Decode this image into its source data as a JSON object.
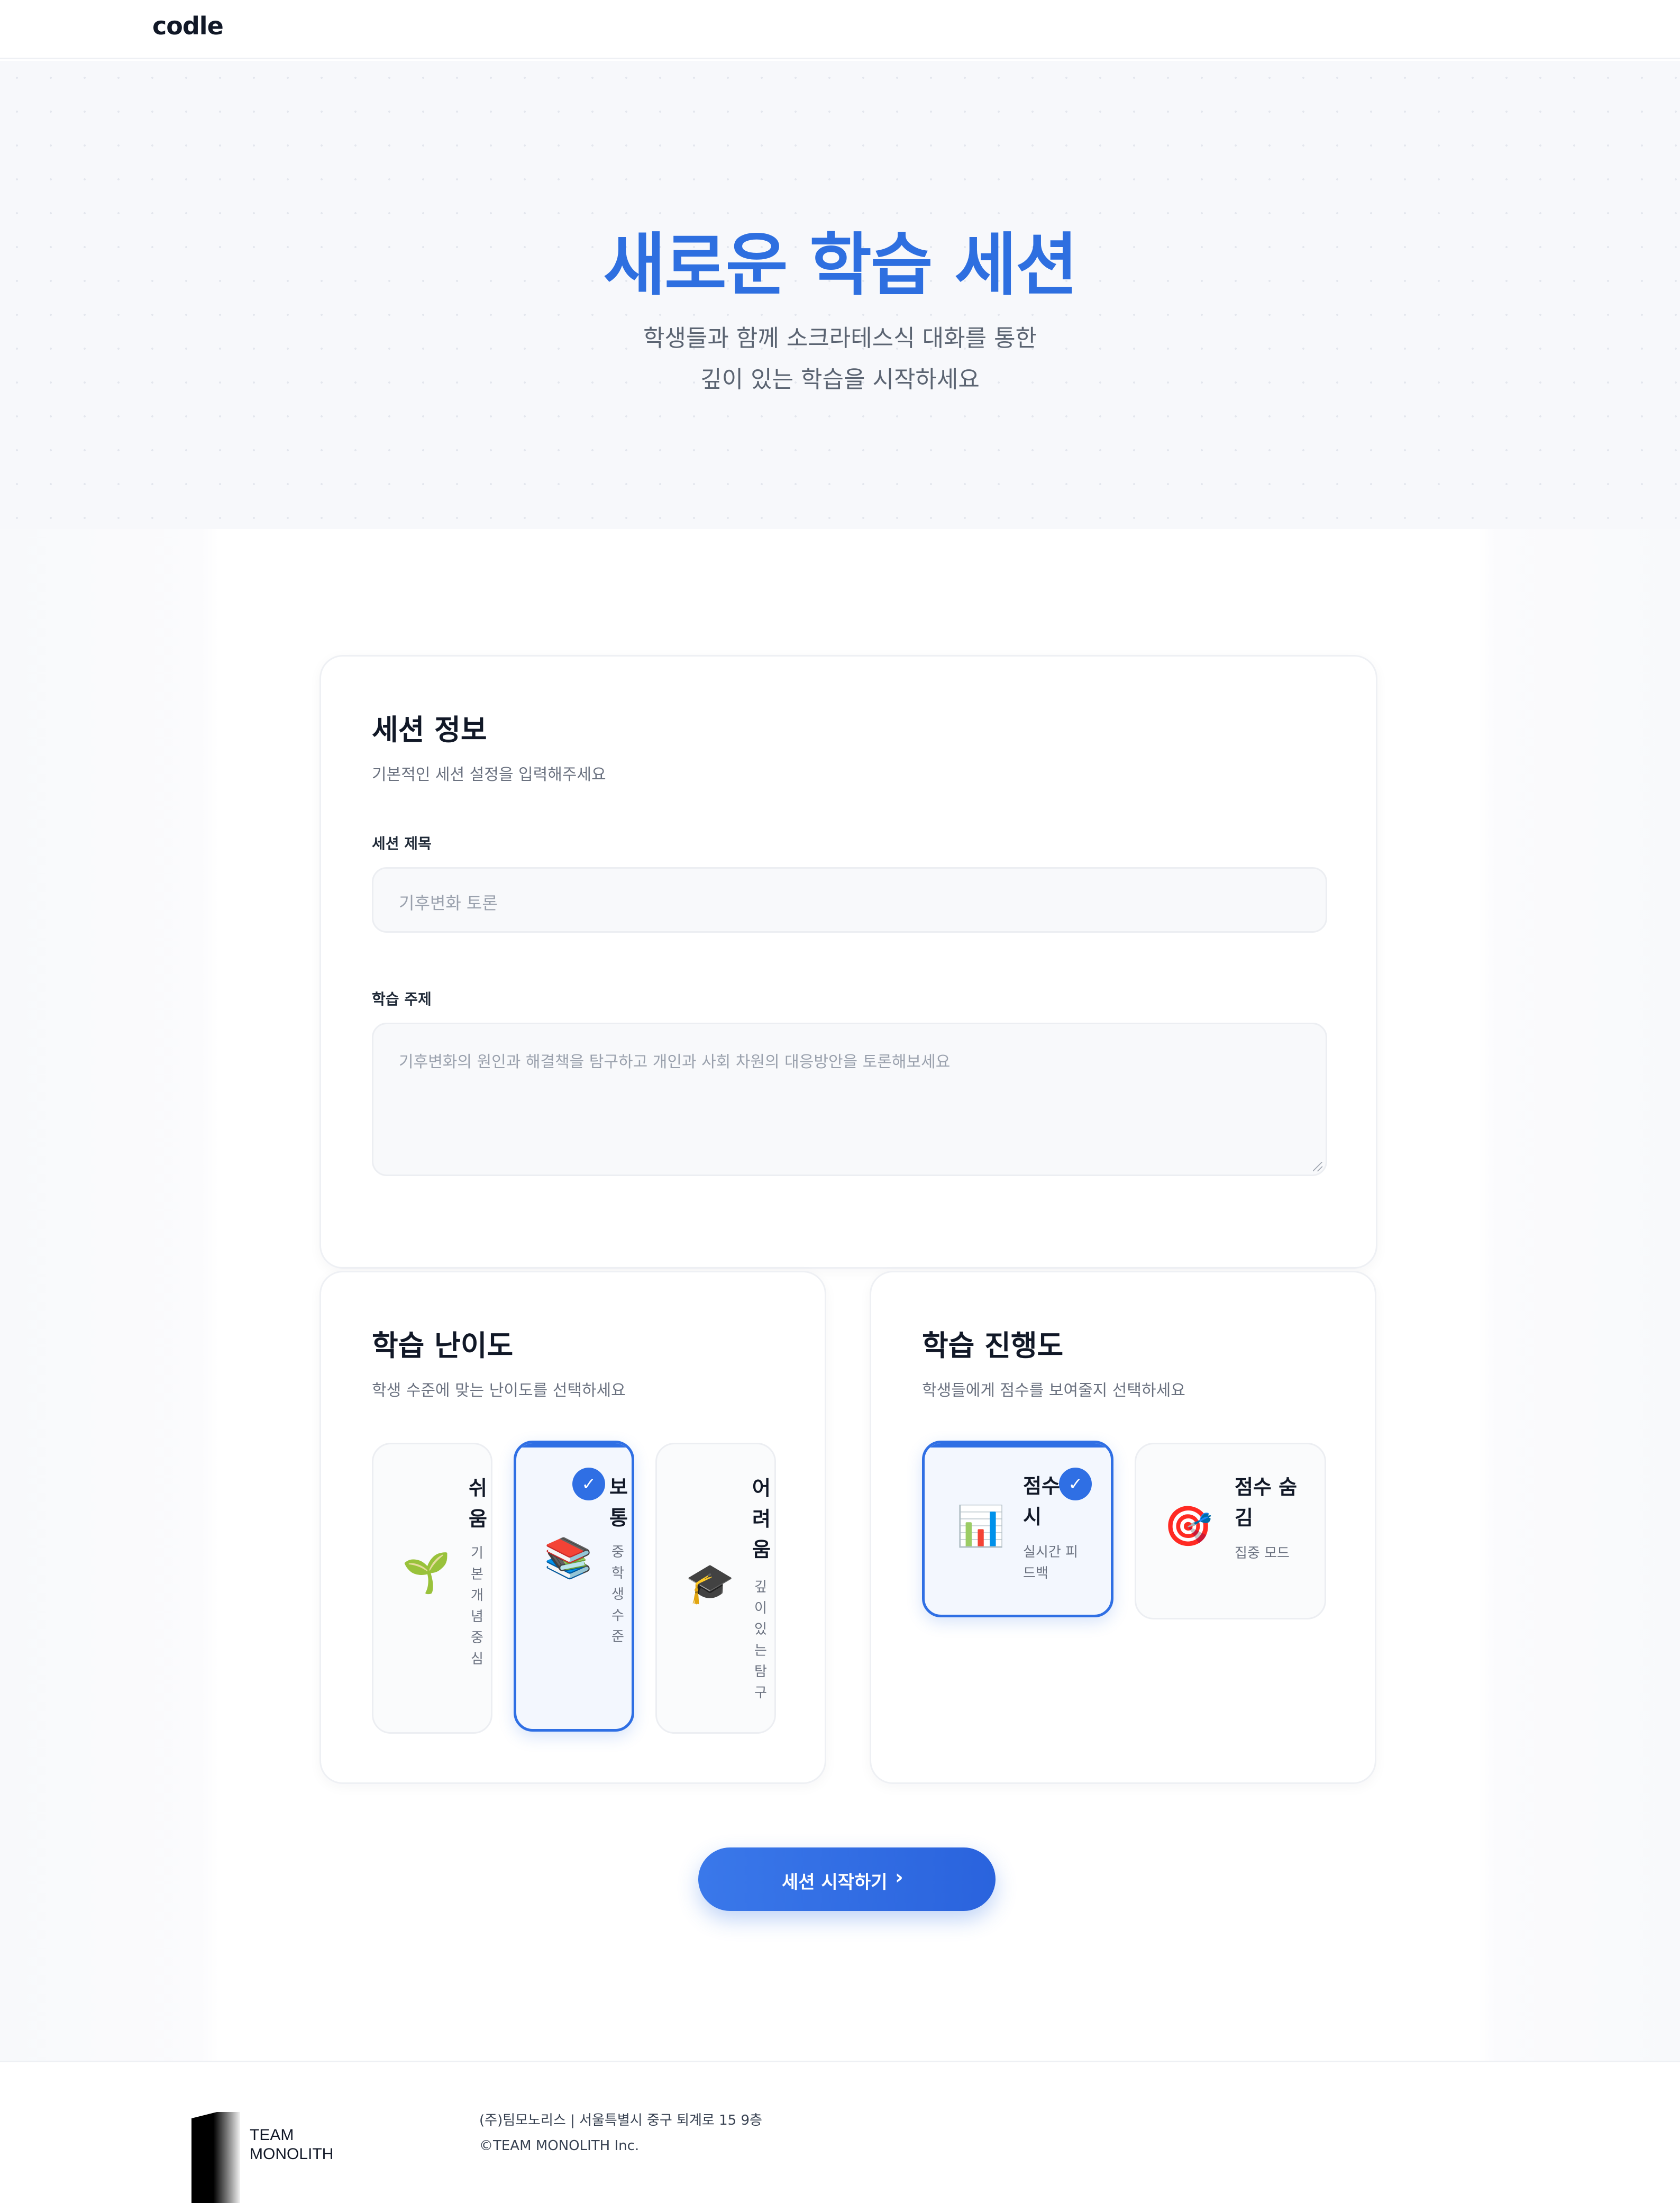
{
  "header": {
    "logo_text": "codle",
    "logo_pin_color": "#2f6fe4"
  },
  "hero": {
    "title": "새로운 학습 세션",
    "subtitle_line1": "학생들과 함께 소크라테스식 대화를 통한",
    "subtitle_line2": "깊이 있는 학습을 시작하세요"
  },
  "session_info": {
    "title": "세션 정보",
    "description": "기본적인 세션 설정을 입력해주세요",
    "title_field": {
      "label": "세션 제목",
      "placeholder": "기후변화 토론"
    },
    "topic_field": {
      "label": "학습 주제",
      "placeholder": "기후변화의 원인과 해결책을 탐구하고 개인과 사회 차원의 대응방안을 토론해보세요"
    }
  },
  "difficulty": {
    "title": "학습 난이도",
    "description": "학생 수준에 맞는 난이도를 선택하세요",
    "options": [
      {
        "emoji": "🌱",
        "icon": "seedling-icon",
        "label": "쉬움",
        "desc": "기본개념중심",
        "selected": false
      },
      {
        "emoji": "📚",
        "icon": "books-icon",
        "label": "보통",
        "desc": "중학생수준",
        "selected": true
      },
      {
        "emoji": "🎓",
        "icon": "graduation-cap-icon",
        "label": "어려움",
        "desc": "깊이있는탐구",
        "selected": false
      }
    ]
  },
  "progress": {
    "title": "학습 진행도",
    "description": "학생들에게 점수를 보여줄지 선택하세요",
    "options": [
      {
        "emoji": "📊",
        "icon": "bar-chart-icon",
        "label": "점수 표시",
        "label_visible": "점수 시",
        "desc": "실시간 피드백",
        "selected": true
      },
      {
        "emoji": "🎯",
        "icon": "target-icon",
        "label": "점수 숨김",
        "desc": "집중 모드",
        "selected": false
      }
    ]
  },
  "actions": {
    "start_label": "세션 시작하기",
    "start_icon": "chevron-right-icon"
  },
  "footer": {
    "brand_line1": "TEAM",
    "brand_line2": "MONOLITH",
    "company_info": "(주)팀모노리스 | 서울특별시 중구 퇴계로 15 9층",
    "copyright": "©TEAM MONOLITH Inc."
  },
  "colors": {
    "accent": "#2f6fe4",
    "hero_title": "#2e6fe0",
    "text": "#111827",
    "muted": "#6b7280"
  }
}
